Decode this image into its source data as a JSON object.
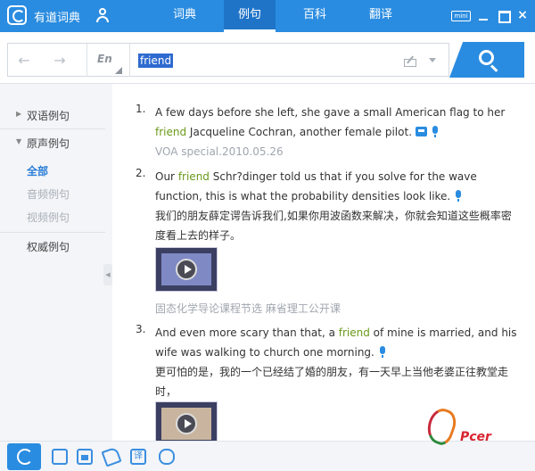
{
  "app": {
    "title": "有道词典"
  },
  "nav": {
    "tabs": [
      "词典",
      "例句",
      "百科",
      "翻译"
    ],
    "active": "例句"
  },
  "window": {
    "mini_label": "mini",
    "close_glyph": "×"
  },
  "search": {
    "lang": "En",
    "query": "friend"
  },
  "sidebar": {
    "items": [
      {
        "label": "双语例句",
        "caret": "▶"
      },
      {
        "label": "原声例句",
        "caret": "▼"
      },
      {
        "label": "权威例句"
      }
    ],
    "subitems": [
      {
        "label": "全部",
        "active": true
      },
      {
        "label": "音频例句"
      },
      {
        "label": "视频例句"
      }
    ]
  },
  "examples": [
    {
      "num": "1.",
      "en_before": "A few days before she left, she gave a small American flag to her ",
      "keyword": "friend",
      "en_after": " Jacqueline Cochran, another female pilot.",
      "source": "VOA special.2010.05.26"
    },
    {
      "num": "2.",
      "en_before": "Our ",
      "keyword": "friend",
      "en_after": " Schr?dinger told us that if you solve for the wave function, this is what the probability densities look like.",
      "cn": "我们的朋友薛定谔告诉我们,如果你用波函数来解决，你就会知道这些概率密度看上去的样子。",
      "source": "固态化学导论课程节选 麻省理工公开课"
    },
    {
      "num": "3.",
      "en_before": "And even more scary than that, a ",
      "keyword": "friend",
      "en_after": " of mine is married, and his wife was walking to church one morning.",
      "cn": "更可怕的是，我的一个已经结了婚的朋友，有一天早上当他老婆正往教堂走时，"
    }
  ],
  "watermark": {
    "text": "Pcer"
  },
  "colors": {
    "accent": "#2a8ce0",
    "keyword": "#6a9a1a",
    "muted": "#a0a6ae"
  }
}
